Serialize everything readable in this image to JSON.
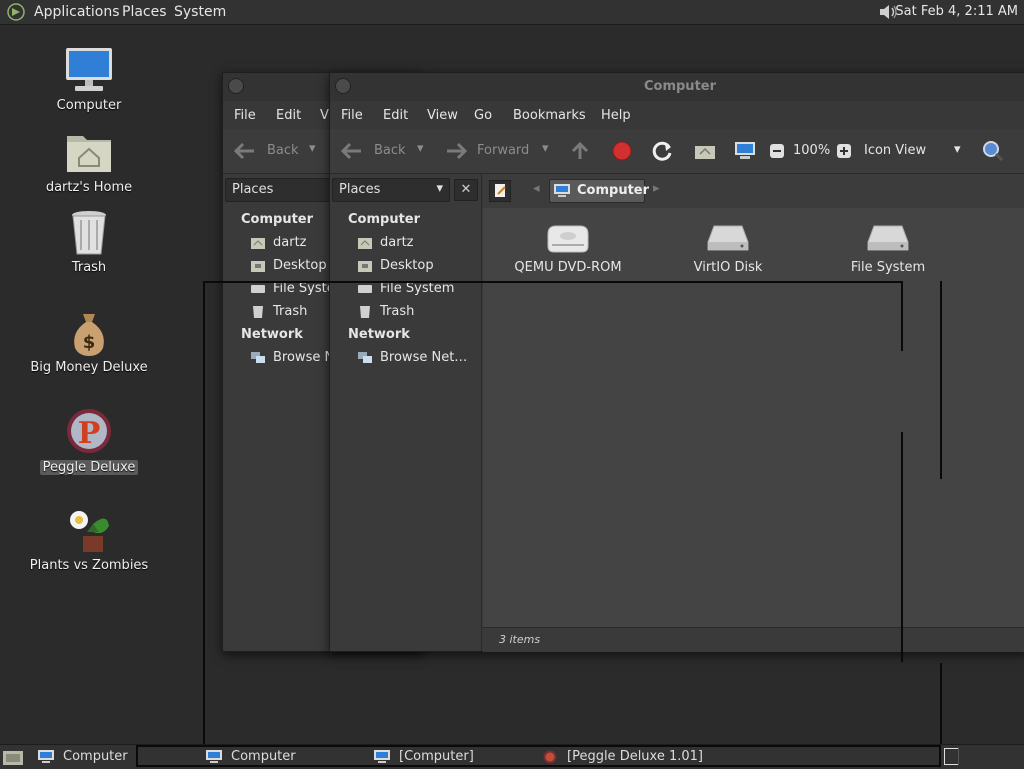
{
  "top_panel": {
    "menus": [
      "Applications",
      "Places",
      "System"
    ],
    "clock": "Sat Feb  4,  2:11 AM"
  },
  "desktop": {
    "icons": [
      {
        "label": "Computer"
      },
      {
        "label": "dartz's Home"
      },
      {
        "label": "Trash"
      },
      {
        "label": "Big Money Deluxe"
      },
      {
        "label": "Peggle Deluxe"
      },
      {
        "label": "Plants vs Zombies"
      }
    ]
  },
  "back_window": {
    "menu": [
      "File",
      "Edit",
      "Vi"
    ],
    "toolbar": {
      "back": "Back"
    },
    "sidebar": {
      "combo": "Places",
      "computer_heading": "Computer",
      "items": [
        "dartz",
        "Desktop",
        "File Syste",
        "Trash"
      ],
      "network_heading": "Network",
      "network_items": [
        "Browse N"
      ]
    }
  },
  "front_window": {
    "title": "Computer",
    "menu": [
      "File",
      "Edit",
      "View",
      "Go",
      "Bookmarks",
      "Help"
    ],
    "toolbar": {
      "back": "Back",
      "forward": "Forward",
      "zoom": "100%",
      "view_mode": "Icon View"
    },
    "sidebar": {
      "combo": "Places",
      "computer_heading": "Computer",
      "items": [
        "dartz",
        "Desktop",
        "File System",
        "Trash"
      ],
      "network_heading": "Network",
      "network_items": [
        "Browse Net…"
      ]
    },
    "location": "Computer",
    "files": [
      {
        "name": "QEMU DVD-ROM"
      },
      {
        "name": "VirtIO Disk"
      },
      {
        "name": "File System"
      }
    ],
    "status": "3 items"
  },
  "taskbar": {
    "items": [
      "Computer",
      "Computer",
      "[Computer]",
      "[Peggle Deluxe 1.01]"
    ]
  }
}
